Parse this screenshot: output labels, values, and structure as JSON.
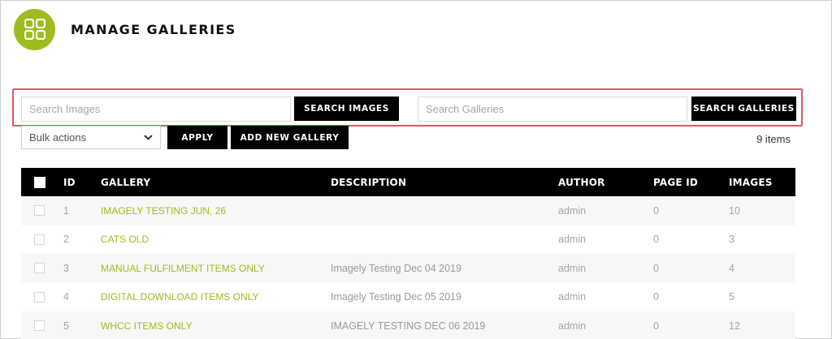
{
  "header": {
    "title": "MANAGE GALLERIES",
    "logo_icon": "grid-icon"
  },
  "search": {
    "images_placeholder": "Search Images",
    "images_button": "SEARCH IMAGES",
    "galleries_placeholder": "Search Galleries",
    "galleries_button": "SEARCH GALLERIES",
    "highlight_color": "#e0585b"
  },
  "toolbar": {
    "bulk_actions": "Bulk actions",
    "apply": "APPLY",
    "add_new": "ADD NEW GALLERY",
    "item_count": "9 items"
  },
  "table": {
    "columns": [
      "ID",
      "GALLERY",
      "DESCRIPTION",
      "AUTHOR",
      "PAGE ID",
      "IMAGES"
    ],
    "rows": [
      {
        "id": "1",
        "gallery": "IMAGELY TESTING JUN, 26",
        "description": "",
        "author": "admin",
        "page_id": "0",
        "images": "10"
      },
      {
        "id": "2",
        "gallery": "CATS OLD",
        "description": "",
        "author": "admin",
        "page_id": "0",
        "images": "3"
      },
      {
        "id": "3",
        "gallery": "MANUAL FULFILMENT ITEMS ONLY",
        "description": "Imagely Testing Dec 04 2019",
        "author": "admin",
        "page_id": "0",
        "images": "4"
      },
      {
        "id": "4",
        "gallery": "DIGITAL DOWNLOAD ITEMS ONLY",
        "description": "Imagely Testing Dec 05 2019",
        "author": "admin",
        "page_id": "0",
        "images": "5"
      },
      {
        "id": "5",
        "gallery": "WHCC ITEMS ONLY",
        "description": "IMAGELY TESTING DEC 06 2019",
        "author": "admin",
        "page_id": "0",
        "images": "12"
      }
    ]
  },
  "colors": {
    "accent": "#9ebc1f",
    "header_bg": "#000000"
  }
}
